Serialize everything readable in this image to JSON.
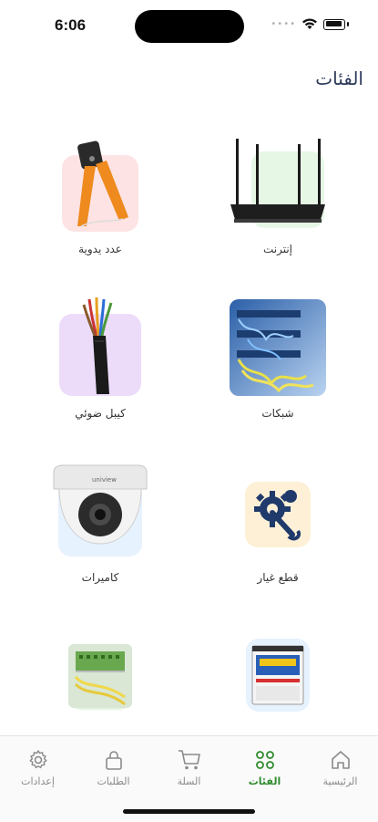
{
  "status_bar": {
    "time": "6:06"
  },
  "header": {
    "title": "الفئات"
  },
  "categories": [
    {
      "label": "إنترنت",
      "icon": "wifi-router",
      "tile_color": "#e6f7e6"
    },
    {
      "label": "عدد يدوية",
      "icon": "crimping-tool",
      "tile_color": "#fde3e3"
    },
    {
      "label": "شبكات",
      "icon": "network-patch-panel",
      "tile_color": "#e3eefb"
    },
    {
      "label": "كيبل ضوئي",
      "icon": "fiber-cable",
      "tile_color": "#ecdcfa"
    },
    {
      "label": "قطع غيار",
      "icon": "gear-wrench",
      "tile_color": "#fdf0d6"
    },
    {
      "label": "كاميرات",
      "icon": "dome-camera",
      "tile_color": "#e6f2fd"
    },
    {
      "label": "",
      "icon": "battery-box",
      "tile_color": "#e6f2fd"
    },
    {
      "label": "",
      "icon": "fiber-panel",
      "tile_color": "#e3f5e3"
    }
  ],
  "tabbar": {
    "items": [
      {
        "label": "الرئيسية",
        "icon": "home-icon",
        "active": false
      },
      {
        "label": "الفئات",
        "icon": "categories-icon",
        "active": true
      },
      {
        "label": "السلة",
        "icon": "cart-icon",
        "active": false
      },
      {
        "label": "الطلبات",
        "icon": "lock-bag-icon",
        "active": false
      },
      {
        "label": "إعدادات",
        "icon": "gear-icon",
        "active": false
      }
    ],
    "active_color": "#2e8b2e",
    "inactive_color": "#8a8a8a"
  }
}
